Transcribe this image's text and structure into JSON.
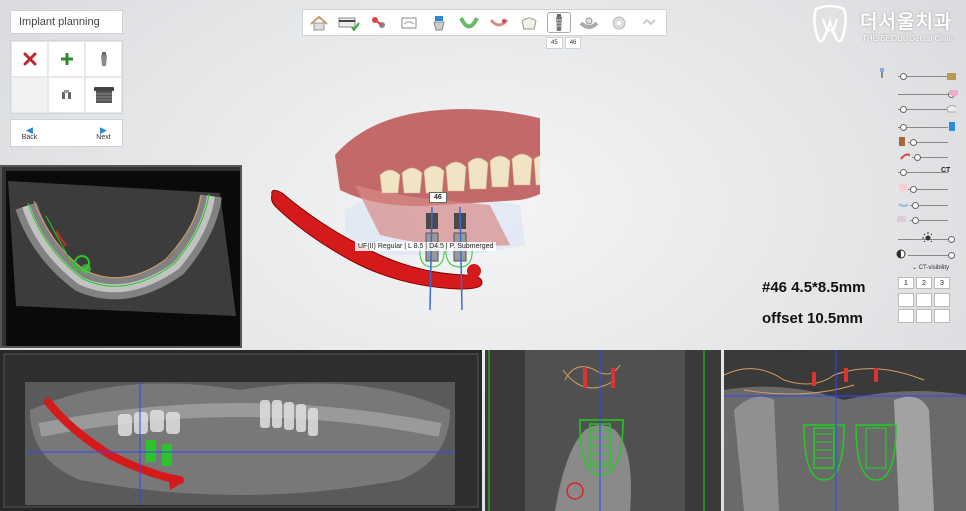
{
  "panel": {
    "title": "Implant planning",
    "back_label": "Back",
    "next_label": "Next"
  },
  "toolbar": {
    "tooth_tabs": [
      "45",
      "46"
    ]
  },
  "logo": {
    "korean": "더서울치과",
    "english": "THE SEOUL Dental Clinic"
  },
  "sliders": {
    "ct_label": "CT",
    "ct_visibility_label": "CT-visibility",
    "view_numbers": [
      "1",
      "2",
      "3"
    ]
  },
  "implant": {
    "tooth_tag": "46",
    "description": "UF(II) Regular | L 8.5 | D4.5 | P. Submerged",
    "size_text": "#46 4.5*8.5mm",
    "offset_text": "offset 10.5mm"
  },
  "colors": {
    "nerve": "#d40000",
    "implant": "#22cc44",
    "axis_blue": "#2233ff",
    "accent": "#2a8bd6"
  }
}
